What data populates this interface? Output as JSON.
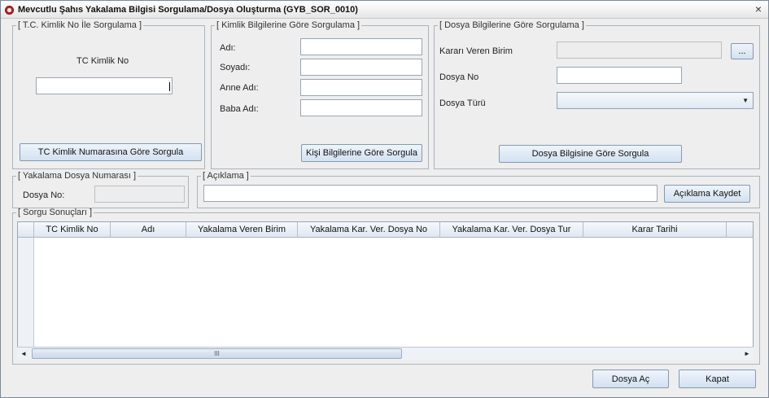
{
  "window": {
    "title": "Mevcutlu Şahıs Yakalama Bilgisi Sorgulama/Dosya Oluşturma  (GYB_SOR_0010)",
    "close_glyph": "×"
  },
  "tc_group": {
    "legend": "[ T.C. Kimlik No İle Sorgulama ]",
    "label": "TC Kimlik No",
    "value": "",
    "button": "TC Kimlik Numarasına Göre Sorgula"
  },
  "kimlik_group": {
    "legend": "[ Kimlik Bilgilerine Göre Sorgulama ]",
    "fields": [
      {
        "label": "Adı:",
        "value": ""
      },
      {
        "label": "Soyadı:",
        "value": ""
      },
      {
        "label": "Anne Adı:",
        "value": ""
      },
      {
        "label": "Baba Adı:",
        "value": ""
      }
    ],
    "button": "Kişi Bilgilerine Göre Sorgula"
  },
  "dosya_group": {
    "legend": "[ Dosya Bilgilerine Göre Sorgulama ]",
    "karar_label": "Kararı Veren Birim",
    "karar_value": "",
    "browse_button": "...",
    "dosya_no_label": "Dosya No",
    "dosya_no_value": "",
    "dosya_turu_label": "Dosya Türü",
    "dosya_turu_value": "",
    "button": "Dosya Bilgisine Göre Sorgula"
  },
  "yakalama_group": {
    "legend": "[ Yakalama Dosya Numarası ]",
    "label": "Dosya No:",
    "value": ""
  },
  "aciklama_group": {
    "legend": "[ Açıklama ]",
    "value": "",
    "button": "Açıklama Kaydet"
  },
  "results_group": {
    "legend": "[ Sorgu Sonuçları ]",
    "columns": [
      "TC Kimlik No",
      "Adı",
      "Yakalama Veren Birim",
      "Yakalama Kar. Ver. Dosya No",
      "Yakalama Kar. Ver. Dosya Tur",
      "Karar Tarihi"
    ],
    "rows": [],
    "scroll_left": "◄",
    "scroll_right": "►",
    "scroll_thumb_grip": "III"
  },
  "footer": {
    "open_button": "Dosya Aç",
    "close_button": "Kapat"
  },
  "colors": {
    "window_bg": "#eeeeee",
    "button_gradient_top": "#eef4fb",
    "button_gradient_bottom": "#d3e1f1",
    "icon_red": "#c0221e"
  }
}
